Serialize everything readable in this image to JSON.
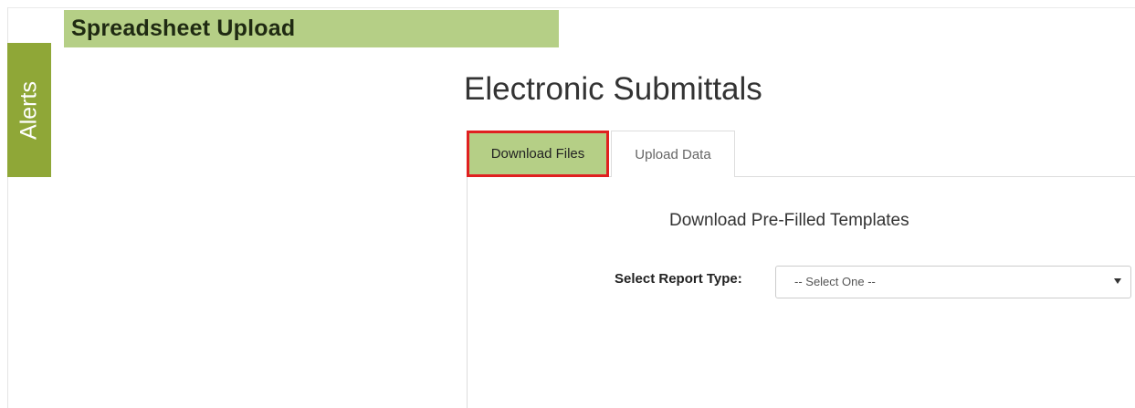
{
  "header": {
    "title": "Spreadsheet Upload"
  },
  "sidebar": {
    "alerts_label": "Alerts"
  },
  "main": {
    "title": "Electronic Submittals",
    "tabs": [
      {
        "label": "Download Files",
        "active": true,
        "highlighted": true
      },
      {
        "label": "Upload Data",
        "active": false
      }
    ],
    "section_heading": "Download Pre-Filled Templates",
    "report_type": {
      "label": "Select Report Type:",
      "selected": "-- Select One --"
    }
  },
  "colors": {
    "header_bg": "#b5cf86",
    "alerts_bg": "#8fa737",
    "active_tab_bg": "#b5cf86",
    "highlight_border": "#e02020"
  },
  "icons": {
    "select_caret": "chevron-down-icon"
  }
}
